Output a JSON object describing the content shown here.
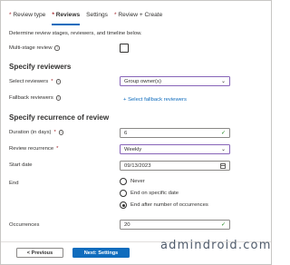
{
  "tabs": [
    {
      "label": "Review type",
      "required": true,
      "active": false
    },
    {
      "label": "Reviews",
      "required": true,
      "active": true
    },
    {
      "label": "Settings",
      "required": false,
      "active": false
    },
    {
      "label": "Review + Create",
      "required": true,
      "active": false
    }
  ],
  "description": "Determine review stages, reviewers, and timeline below.",
  "multi_stage": {
    "label": "Multi-stage review",
    "checked": false,
    "info_icon": "info-icon"
  },
  "reviewers_section": {
    "title": "Specify reviewers",
    "select_reviewers": {
      "label": "Select reviewers",
      "value": "Group owner(s)"
    },
    "fallback_reviewers": {
      "label": "Fallback reviewers",
      "link": "+ Select fallback reviewers"
    }
  },
  "recurrence_section": {
    "title": "Specify recurrence of review",
    "duration": {
      "label": "Duration (in days)",
      "value": "6"
    },
    "recurrence": {
      "label": "Review recurrence",
      "value": "Weekly"
    },
    "start_date": {
      "label": "Start date",
      "value": "09/13/2023"
    },
    "end": {
      "label": "End",
      "options": [
        "Never",
        "End on specific date",
        "End after number of occurrences"
      ],
      "selected_index": 2
    },
    "occurrences": {
      "label": "Occurrences",
      "value": "20"
    }
  },
  "footer": {
    "previous_label": "< Previous",
    "next_label": "Next: Settings"
  },
  "watermark": "admindroid.com",
  "colors": {
    "accent": "#0f6cbd",
    "required": "#a4262c",
    "valid": "#107c10",
    "select_border": "#8764b8"
  }
}
